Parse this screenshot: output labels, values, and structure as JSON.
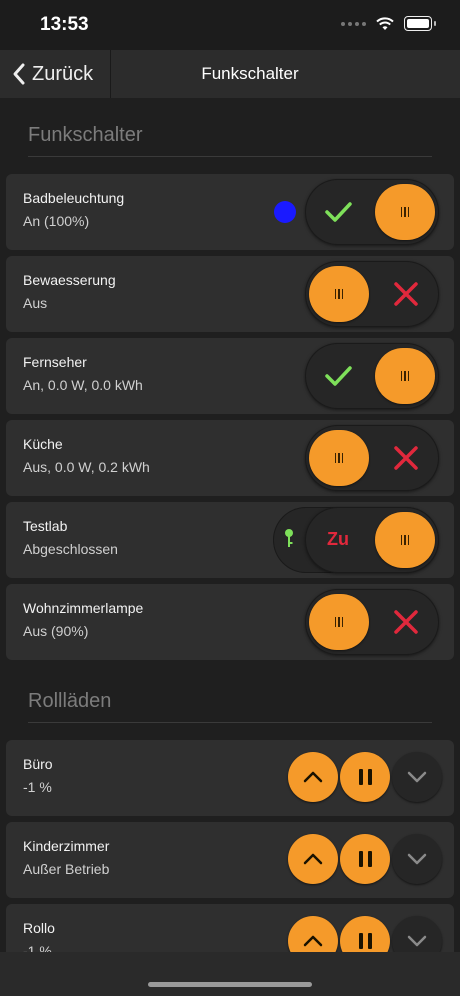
{
  "status_bar": {
    "time": "13:53"
  },
  "nav": {
    "back_label": "Zurück",
    "title": "Funkschalter"
  },
  "sections": {
    "switches_title": "Funkschalter",
    "shutters_title": "Rollläden"
  },
  "switches": [
    {
      "name": "Badbeleuchtung",
      "status": "An (100%)",
      "state": "on",
      "indicator_color": "#1a1aff"
    },
    {
      "name": "Bewaesserung",
      "status": "Aus",
      "state": "off"
    },
    {
      "name": "Fernseher",
      "status": "An, 0.0 W, 0.0 kWh",
      "state": "on"
    },
    {
      "name": "Küche",
      "status": "Aus, 0.0 W, 0.2 kWh",
      "state": "off"
    },
    {
      "name": "Testlab",
      "status": "Abgeschlossen",
      "state": "locked",
      "lock_label": "Zu"
    },
    {
      "name": "Wohnzimmerlampe",
      "status": "Aus (90%)",
      "state": "off"
    }
  ],
  "shutters": [
    {
      "name": "Büro",
      "status": "-1 %"
    },
    {
      "name": "Kinderzimmer",
      "status": "Außer Betrieb"
    },
    {
      "name": "Rollo",
      "status": "-1 %"
    }
  ],
  "colors": {
    "accent": "#f59a2a",
    "check": "#7ee05a",
    "cross": "#e1283c",
    "card": "#2f2f2f",
    "background": "#1f1f1f"
  },
  "icons": {
    "on_mark": "check-icon",
    "off_mark": "x-icon",
    "lock": "key-icon",
    "up": "chevron-up-icon",
    "stop": "pause-icon",
    "down": "chevron-down-icon"
  }
}
